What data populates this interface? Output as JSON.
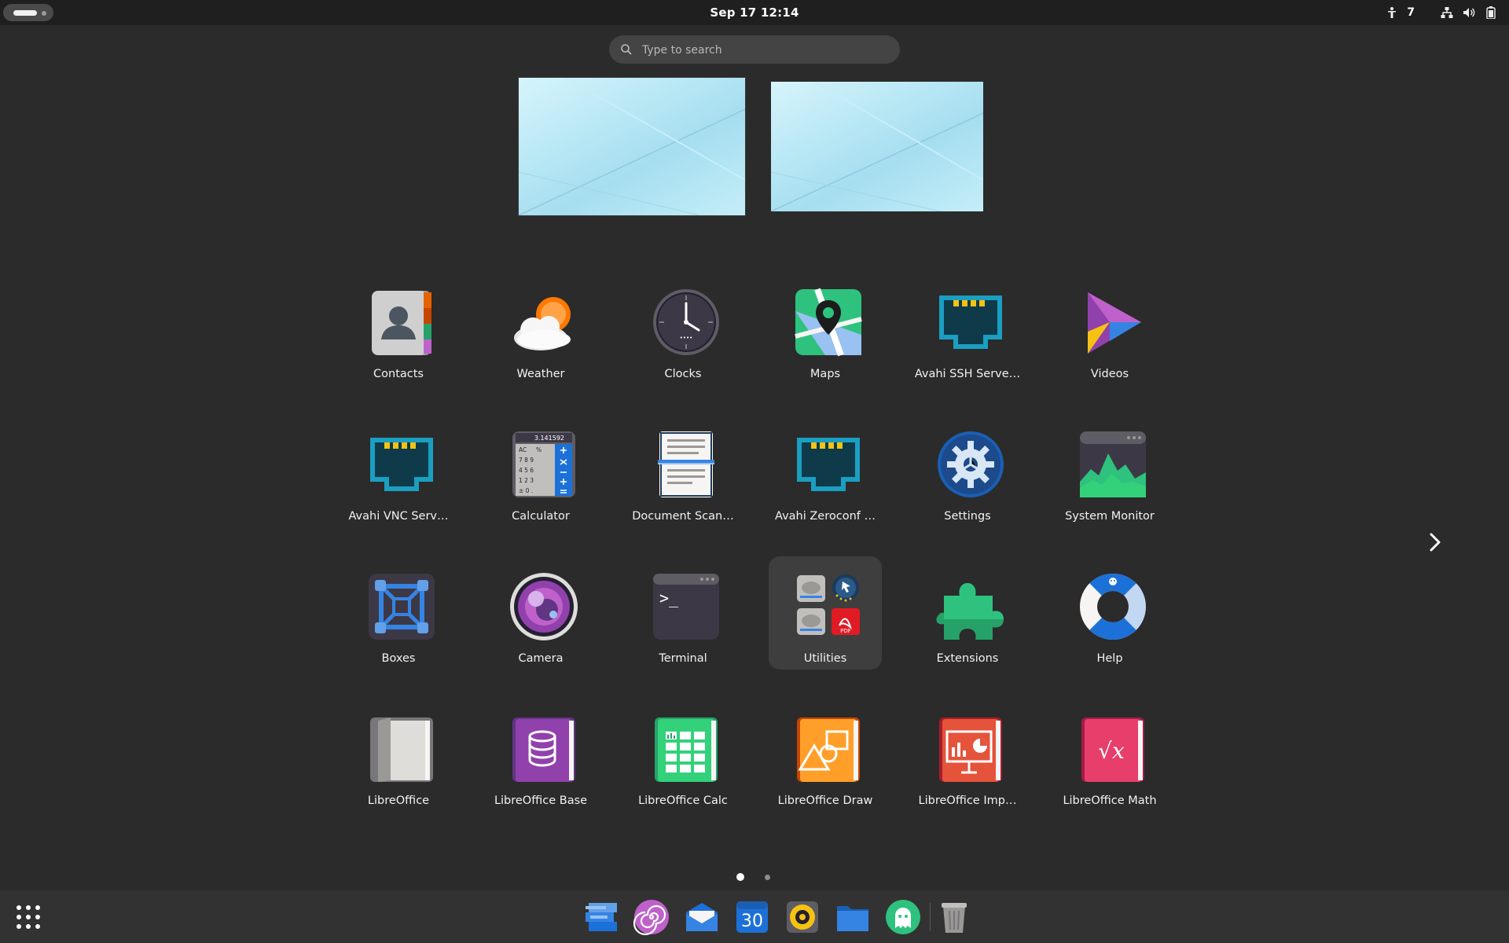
{
  "topbar": {
    "clock": "Sep 17  12:14",
    "notification_count": "7"
  },
  "search": {
    "placeholder": "Type to search"
  },
  "apps": [
    {
      "label": "Contacts",
      "icon": "contacts-icon"
    },
    {
      "label": "Weather",
      "icon": "weather-icon"
    },
    {
      "label": "Clocks",
      "icon": "clock-icon"
    },
    {
      "label": "Maps",
      "icon": "maps-icon"
    },
    {
      "label": "Avahi SSH Serve…",
      "icon": "network-port-icon"
    },
    {
      "label": "Videos",
      "icon": "videos-icon"
    },
    {
      "label": "Avahi VNC Serv…",
      "icon": "network-port-icon"
    },
    {
      "label": "Calculator",
      "icon": "calculator-icon"
    },
    {
      "label": "Document Scan…",
      "icon": "scanner-icon"
    },
    {
      "label": "Avahi Zeroconf …",
      "icon": "network-port-icon"
    },
    {
      "label": "Settings",
      "icon": "gear-icon"
    },
    {
      "label": "System Monitor",
      "icon": "system-monitor-icon"
    },
    {
      "label": "Boxes",
      "icon": "boxes-icon"
    },
    {
      "label": "Camera",
      "icon": "camera-icon"
    },
    {
      "label": "Terminal",
      "icon": "terminal-icon"
    },
    {
      "label": "Utilities",
      "icon": "folder-icon"
    },
    {
      "label": "Extensions",
      "icon": "puzzle-icon"
    },
    {
      "label": "Help",
      "icon": "lifebuoy-icon"
    },
    {
      "label": "LibreOffice",
      "icon": "libreoffice-icon"
    },
    {
      "label": "LibreOffice Base",
      "icon": "libreoffice-base-icon"
    },
    {
      "label": "LibreOffice Calc",
      "icon": "libreoffice-calc-icon"
    },
    {
      "label": "LibreOffice Draw",
      "icon": "libreoffice-draw-icon"
    },
    {
      "label": "LibreOffice Imp…",
      "icon": "libreoffice-impress-icon"
    },
    {
      "label": "LibreOffice Math",
      "icon": "libreoffice-math-icon"
    }
  ],
  "icon_text": {
    "calculator_display": "3.141592",
    "calculator_keys": [
      "AC",
      "%",
      "7 8 9",
      "4 5 6",
      "1 2 3",
      "± 0 ."
    ],
    "terminal_prompt": ">_",
    "math_symbol": "√x",
    "pdf_badge": "PDF",
    "calendar_day": "30"
  },
  "pager": {
    "current_page": 1,
    "total_pages": 2
  },
  "dash": {
    "items": [
      "window-switcher-icon",
      "helix-icon",
      "mail-icon",
      "calendar-icon",
      "music-player-icon",
      "files-folder-icon",
      "ghost-icon",
      "trash-icon"
    ]
  },
  "colors": {
    "background": "#2b2b2b",
    "topbar": "#1f1f1f",
    "dash": "#323232",
    "accent": "#3584e4"
  }
}
